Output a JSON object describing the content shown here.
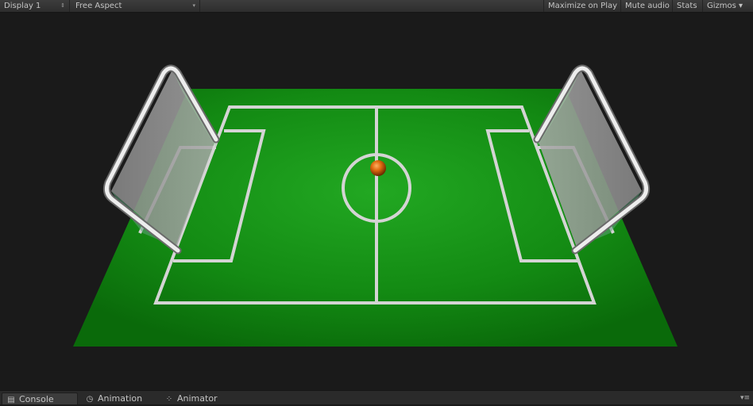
{
  "toolbar": {
    "display_label": "Display 1",
    "display_arrow": "⇕",
    "aspect_label": "Free Aspect",
    "aspect_arrow": "▾",
    "maximize_label": "Maximize on Play",
    "mute_label": "Mute audio",
    "stats_label": "Stats",
    "gizmos_label": "Gizmos",
    "gizmos_arrow": "▾"
  },
  "scene": {
    "background_color": "#1a1a1a",
    "pitch_color_center": "#1f9d1f",
    "pitch_color_edge": "#0b6e0b",
    "line_color": "#d9d9d9",
    "goal_frame_color": "#e8e8e8",
    "ball_color": "#e06a10"
  },
  "tabs": [
    {
      "label": "Console",
      "icon": "console-icon",
      "glyph": "▤"
    },
    {
      "label": "Animation",
      "icon": "animation-icon",
      "glyph": "◷"
    },
    {
      "label": "Animator",
      "icon": "animator-icon",
      "glyph": "⁘"
    }
  ],
  "tab_menu_glyph": "▾≡"
}
